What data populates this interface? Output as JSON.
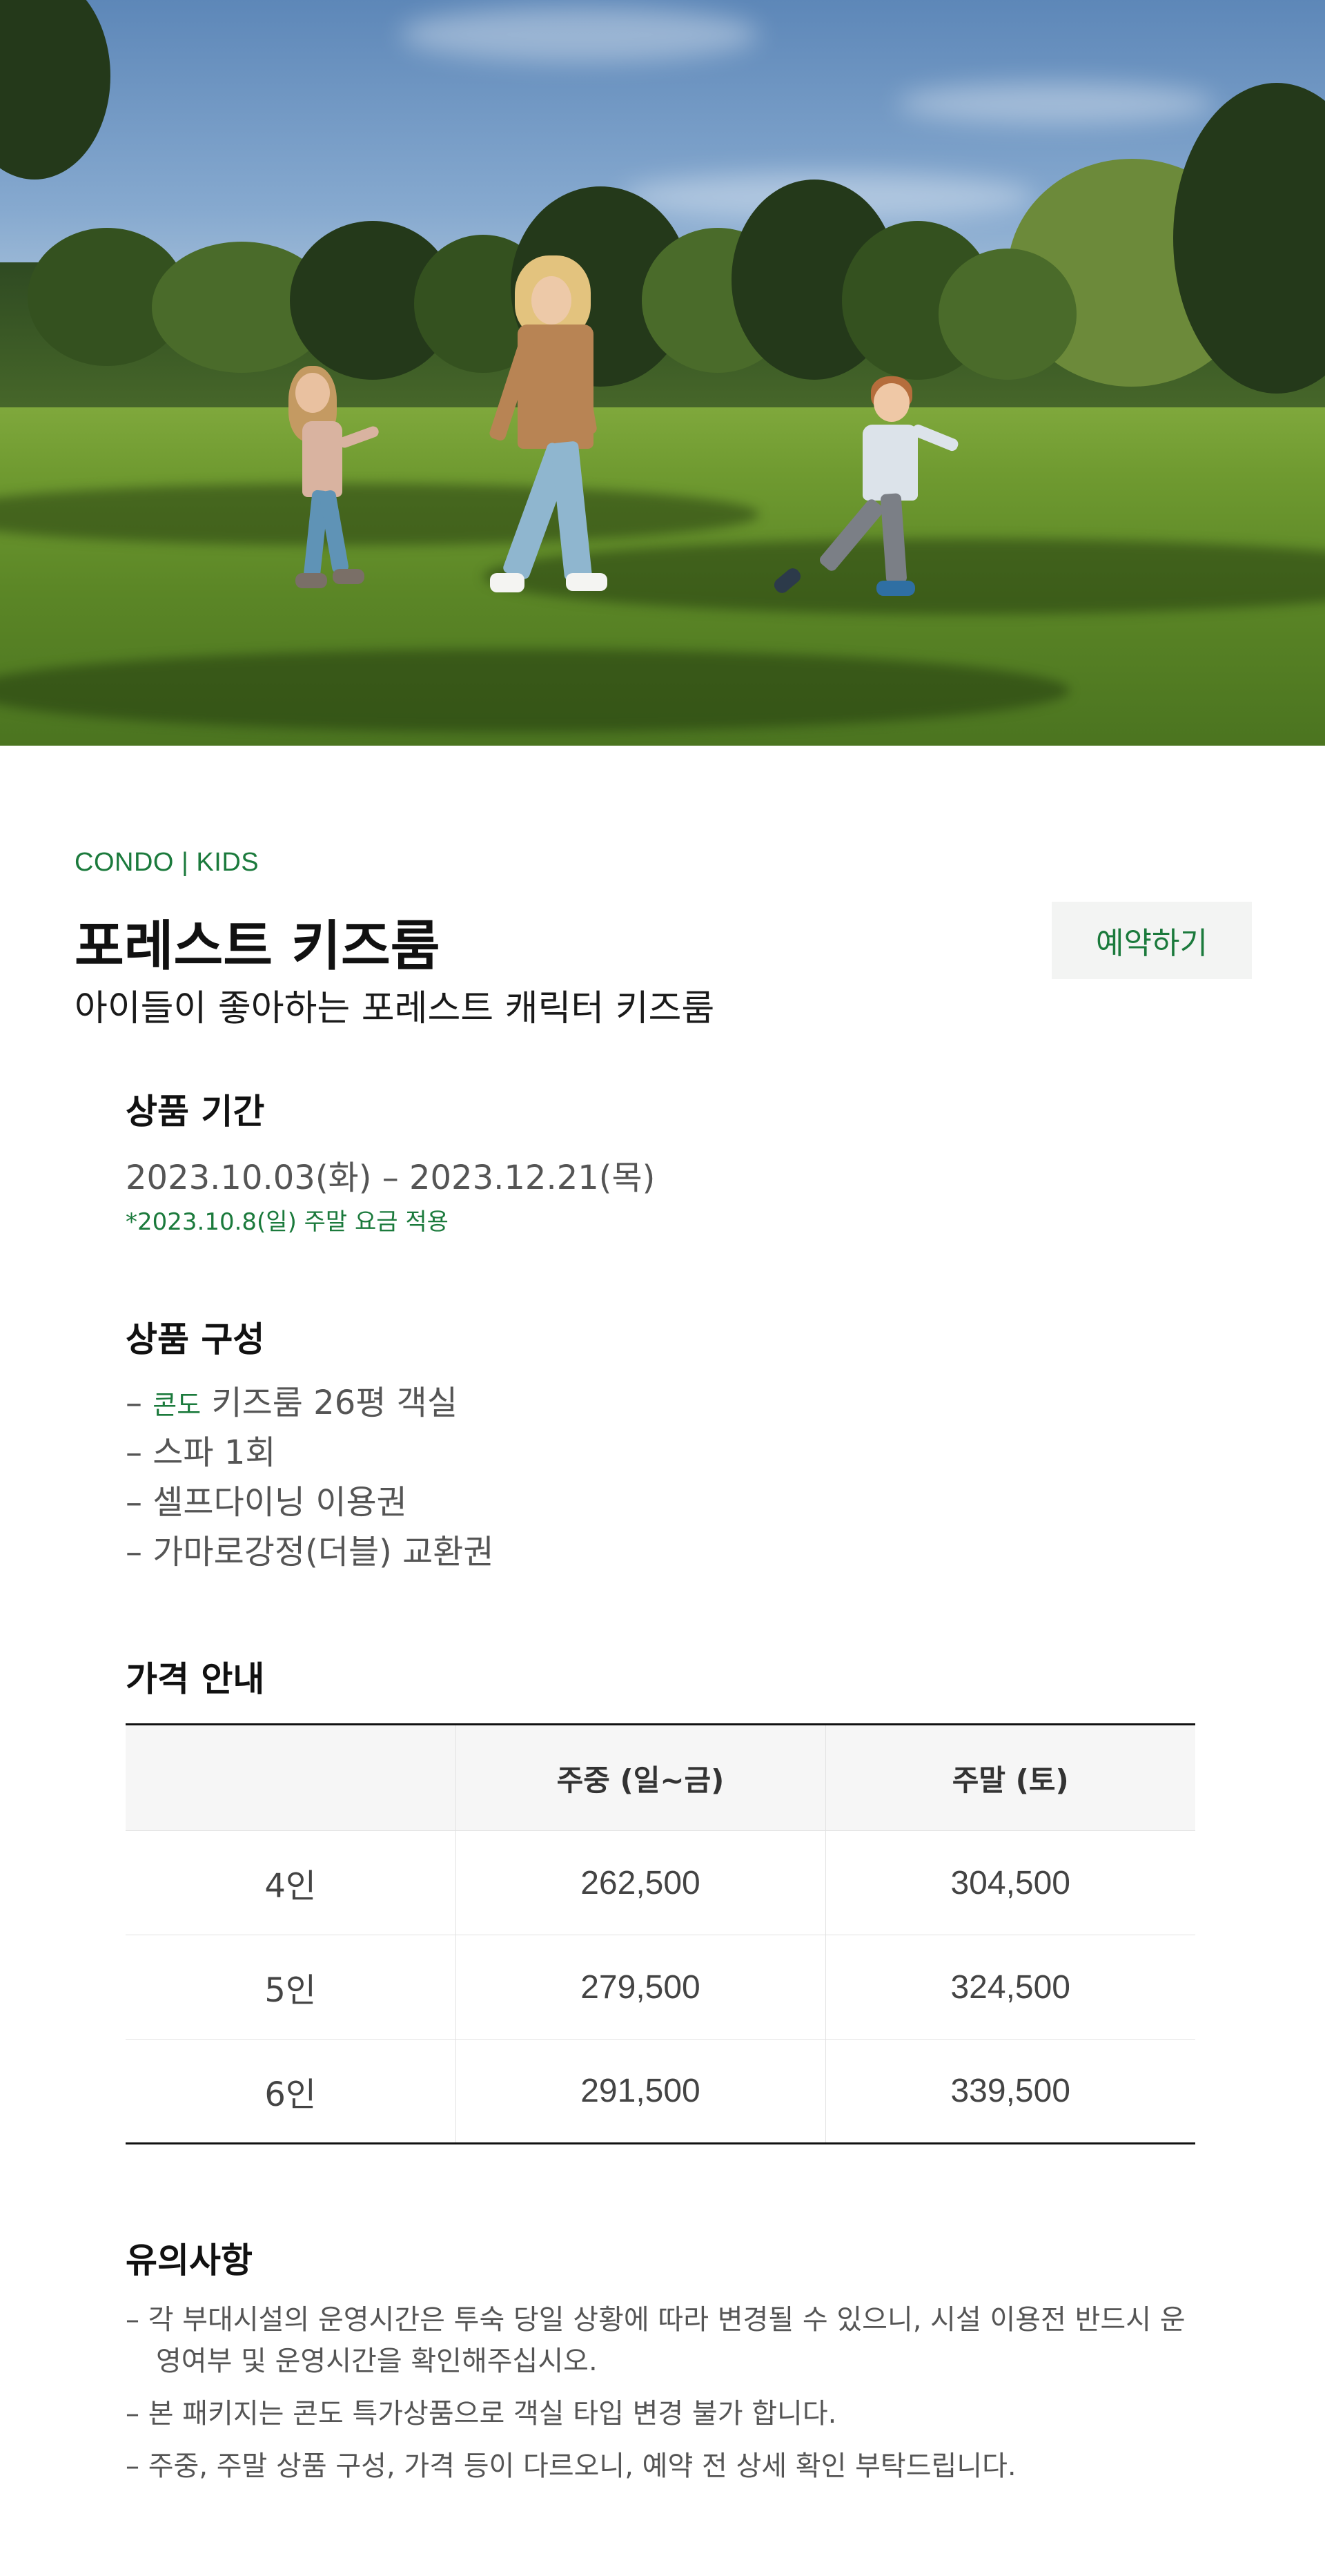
{
  "hero": {
    "icon": "hero-photo-family-on-lawn"
  },
  "header": {
    "category": "CONDO | KIDS",
    "title": "포레스트 키즈룸",
    "subtitle": "아이들이 좋아하는 포레스트 캐릭터 키즈룸",
    "reserve_label": "예약하기"
  },
  "period": {
    "title": "상품 기간",
    "dates": "2023.10.03(화) – 2023.12.21(목)",
    "note": "*2023.10.8(일) 주말 요금 적용"
  },
  "composition": {
    "title": "상품 구성",
    "items": [
      {
        "prefix": "– ",
        "tag": "콘도",
        "text": " 키즈룸 26평 객실"
      },
      {
        "prefix": "– ",
        "tag": "",
        "text": "스파 1회"
      },
      {
        "prefix": "– ",
        "tag": "",
        "text": "셀프다이닝 이용권"
      },
      {
        "prefix": "– ",
        "tag": "",
        "text": "가마로강정(더블) 교환권"
      }
    ]
  },
  "pricing": {
    "title": "가격 안내",
    "headers": [
      "",
      "주중 (일~금)",
      "주말 (토)"
    ],
    "rows": [
      [
        "4인",
        "262,500",
        "304,500"
      ],
      [
        "5인",
        "279,500",
        "324,500"
      ],
      [
        "6인",
        "291,500",
        "339,500"
      ]
    ]
  },
  "notes": {
    "title": "유의사항",
    "items": [
      "– 각 부대시설의 운영시간은 투숙 당일 상황에 따라 변경될 수 있으니, 시설 이용전 반드시 운영여부 및 운영시간을 확인해주십시오.",
      "– 본 패키지는 콘도 특가상품으로 객실 타입 변경 불가 합니다.",
      "– 주중, 주말 상품 구성, 가격 등이 다르오니, 예약 전 상세 확인 부탁드립니다."
    ]
  },
  "colors": {
    "accent": "#1b7a3c",
    "button_bg": "#f3f4f3",
    "table_header_bg": "#f6f6f6"
  }
}
